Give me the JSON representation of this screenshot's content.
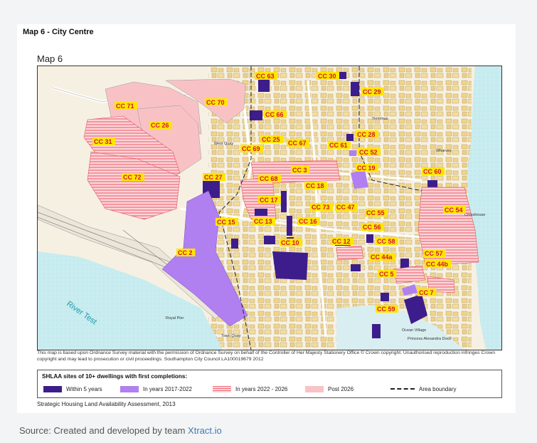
{
  "card": {
    "title": "Map 6 - City Centre"
  },
  "map": {
    "heading": "Map 6",
    "river_label": "River Test",
    "place_labels": {
      "west_quay": "West Quay",
      "royal_pier": "Royal Pier",
      "town_quay": "Town Quay",
      "wharves": "Wharves",
      "crosshouse": "Crosshouse",
      "ocean_village": "Ocean Village",
      "princess_dock": "Princess Alexandra Dock",
      "terminus": "Terminus"
    },
    "sites": [
      {
        "id": "cc63",
        "label": "CC 63",
        "category": "within5"
      },
      {
        "id": "cc30",
        "label": "CC 30",
        "category": "within5"
      },
      {
        "id": "cc29",
        "label": "CC 29",
        "category": "within5"
      },
      {
        "id": "cc70",
        "label": "CC 70",
        "category": "post2026"
      },
      {
        "id": "cc66",
        "label": "CC 66",
        "category": "within5"
      },
      {
        "id": "cc71",
        "label": "CC 71",
        "category": "post2026"
      },
      {
        "id": "cc26",
        "label": "CC 26",
        "category": "post2026"
      },
      {
        "id": "cc28",
        "label": "CC 28",
        "category": "within5"
      },
      {
        "id": "cc61",
        "label": "CC 61",
        "category": "y2017"
      },
      {
        "id": "cc52",
        "label": "CC 52",
        "category": "y2017"
      },
      {
        "id": "cc31",
        "label": "CC 31",
        "category": "y2022"
      },
      {
        "id": "cc25",
        "label": "CC 25",
        "category": "within5"
      },
      {
        "id": "cc67",
        "label": "CC 67",
        "category": "within5"
      },
      {
        "id": "cc69",
        "label": "CC 69",
        "category": "within5"
      },
      {
        "id": "cc19",
        "label": "CC 19",
        "category": "y2017"
      },
      {
        "id": "cc3",
        "label": "CC 3",
        "category": "y2022"
      },
      {
        "id": "cc60",
        "label": "CC 60",
        "category": "within5"
      },
      {
        "id": "cc72",
        "label": "CC 72",
        "category": "y2022"
      },
      {
        "id": "cc27",
        "label": "CC 27",
        "category": "within5"
      },
      {
        "id": "cc68",
        "label": "CC 68",
        "category": "y2022"
      },
      {
        "id": "cc18",
        "label": "CC 18",
        "category": "within5"
      },
      {
        "id": "cc17",
        "label": "CC 17",
        "category": "within5"
      },
      {
        "id": "cc73",
        "label": "CC 73",
        "category": "within5"
      },
      {
        "id": "cc47",
        "label": "CC 47",
        "category": "within5"
      },
      {
        "id": "cc54",
        "label": "CC 54",
        "category": "y2022"
      },
      {
        "id": "cc55",
        "label": "CC 55",
        "category": "within5"
      },
      {
        "id": "cc15",
        "label": "CC 15",
        "category": "within5"
      },
      {
        "id": "cc13",
        "label": "CC 13",
        "category": "within5"
      },
      {
        "id": "cc16",
        "label": "CC 16",
        "category": "within5"
      },
      {
        "id": "cc56",
        "label": "CC 56",
        "category": "y2022"
      },
      {
        "id": "cc12",
        "label": "CC 12",
        "category": "within5"
      },
      {
        "id": "cc58",
        "label": "CC 58",
        "category": "within5"
      },
      {
        "id": "cc10",
        "label": "CC 10",
        "category": "within5"
      },
      {
        "id": "cc2",
        "label": "CC 2",
        "category": "y2017"
      },
      {
        "id": "cc57",
        "label": "CC 57",
        "category": "y2022"
      },
      {
        "id": "cc44a",
        "label": "CC 44a",
        "category": "y2022"
      },
      {
        "id": "cc44b",
        "label": "CC 44b",
        "category": "y2017"
      },
      {
        "id": "cc5",
        "label": "CC 5",
        "category": "within5"
      },
      {
        "id": "cc7",
        "label": "CC 7",
        "category": "within5"
      },
      {
        "id": "cc59",
        "label": "CC 59",
        "category": "within5"
      }
    ]
  },
  "copyright": "This map is based upon Ordnance Survey material with the permission of Ordnance Survey on behalf of the Controller of Her Majesty Stationery Office © Crown copyright. Unauthorised reproduction infringes Crown copyright and may lead to prosecution or civil proceedings. Southampton City Council LA100019679 2012",
  "legend": {
    "title": "SHLAA sites of 10+ dwellings with first completions:",
    "items": [
      {
        "label": "Within 5 years",
        "color": "#3d1d8c"
      },
      {
        "label": "In years 2017-2022",
        "color": "#b07ff0"
      },
      {
        "label": "In years 2022 - 2026",
        "color": "#f28a94"
      },
      {
        "label": "Post 2026",
        "color": "#f7c3c6"
      }
    ],
    "boundary_label": "Area boundary"
  },
  "footnote": "Strategic Housing Land Availability Assessment, 2013",
  "source": {
    "prefix": "Source: Created and developed by team ",
    "brand": "Xtract.io"
  }
}
